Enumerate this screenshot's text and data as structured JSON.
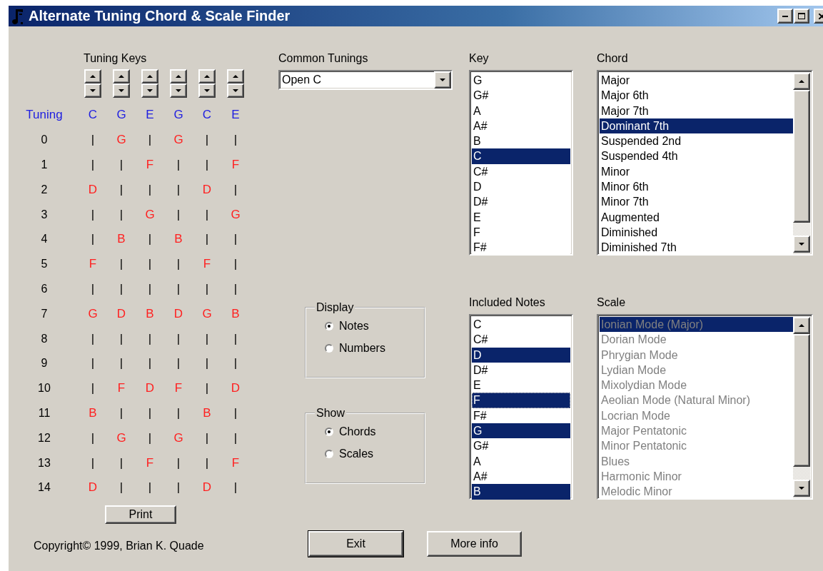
{
  "window": {
    "title": "Alternate Tuning Chord & Scale Finder"
  },
  "tuning_keys": {
    "label": "Tuning Keys"
  },
  "fretboard": {
    "header_label": "Tuning",
    "strings": [
      "C",
      "G",
      "E",
      "G",
      "C",
      "E"
    ],
    "rows": [
      {
        "fret": "0",
        "cells": [
          {
            "text": "|",
            "kind": "fret"
          },
          {
            "text": "G",
            "kind": "note"
          },
          {
            "text": "|",
            "kind": "fret"
          },
          {
            "text": "G",
            "kind": "note"
          },
          {
            "text": "|",
            "kind": "fret"
          },
          {
            "text": "|",
            "kind": "fret"
          }
        ]
      },
      {
        "fret": "1",
        "cells": [
          {
            "text": "|",
            "kind": "fret"
          },
          {
            "text": "|",
            "kind": "fret"
          },
          {
            "text": "F",
            "kind": "note"
          },
          {
            "text": "|",
            "kind": "fret"
          },
          {
            "text": "|",
            "kind": "fret"
          },
          {
            "text": "F",
            "kind": "note"
          }
        ]
      },
      {
        "fret": "2",
        "cells": [
          {
            "text": "D",
            "kind": "note"
          },
          {
            "text": "|",
            "kind": "fret"
          },
          {
            "text": "|",
            "kind": "fret"
          },
          {
            "text": "|",
            "kind": "fret"
          },
          {
            "text": "D",
            "kind": "note"
          },
          {
            "text": "|",
            "kind": "fret"
          }
        ]
      },
      {
        "fret": "3",
        "cells": [
          {
            "text": "|",
            "kind": "fret"
          },
          {
            "text": "|",
            "kind": "fret"
          },
          {
            "text": "G",
            "kind": "note"
          },
          {
            "text": "|",
            "kind": "fret"
          },
          {
            "text": "|",
            "kind": "fret"
          },
          {
            "text": "G",
            "kind": "note"
          }
        ]
      },
      {
        "fret": "4",
        "cells": [
          {
            "text": "|",
            "kind": "fret"
          },
          {
            "text": "B",
            "kind": "note"
          },
          {
            "text": "|",
            "kind": "fret"
          },
          {
            "text": "B",
            "kind": "note"
          },
          {
            "text": "|",
            "kind": "fret"
          },
          {
            "text": "|",
            "kind": "fret"
          }
        ]
      },
      {
        "fret": "5",
        "cells": [
          {
            "text": "F",
            "kind": "note"
          },
          {
            "text": "|",
            "kind": "fret"
          },
          {
            "text": "|",
            "kind": "fret"
          },
          {
            "text": "|",
            "kind": "fret"
          },
          {
            "text": "F",
            "kind": "note"
          },
          {
            "text": "|",
            "kind": "fret"
          }
        ]
      },
      {
        "fret": "6",
        "cells": [
          {
            "text": "|",
            "kind": "fret"
          },
          {
            "text": "|",
            "kind": "fret"
          },
          {
            "text": "|",
            "kind": "fret"
          },
          {
            "text": "|",
            "kind": "fret"
          },
          {
            "text": "|",
            "kind": "fret"
          },
          {
            "text": "|",
            "kind": "fret"
          }
        ]
      },
      {
        "fret": "7",
        "cells": [
          {
            "text": "G",
            "kind": "note"
          },
          {
            "text": "D",
            "kind": "note"
          },
          {
            "text": "B",
            "kind": "note"
          },
          {
            "text": "D",
            "kind": "note"
          },
          {
            "text": "G",
            "kind": "note"
          },
          {
            "text": "B",
            "kind": "note"
          }
        ]
      },
      {
        "fret": "8",
        "cells": [
          {
            "text": "|",
            "kind": "fret"
          },
          {
            "text": "|",
            "kind": "fret"
          },
          {
            "text": "|",
            "kind": "fret"
          },
          {
            "text": "|",
            "kind": "fret"
          },
          {
            "text": "|",
            "kind": "fret"
          },
          {
            "text": "|",
            "kind": "fret"
          }
        ]
      },
      {
        "fret": "9",
        "cells": [
          {
            "text": "|",
            "kind": "fret"
          },
          {
            "text": "|",
            "kind": "fret"
          },
          {
            "text": "|",
            "kind": "fret"
          },
          {
            "text": "|",
            "kind": "fret"
          },
          {
            "text": "|",
            "kind": "fret"
          },
          {
            "text": "|",
            "kind": "fret"
          }
        ]
      },
      {
        "fret": "10",
        "cells": [
          {
            "text": "|",
            "kind": "fret"
          },
          {
            "text": "F",
            "kind": "note"
          },
          {
            "text": "D",
            "kind": "note"
          },
          {
            "text": "F",
            "kind": "note"
          },
          {
            "text": "|",
            "kind": "fret"
          },
          {
            "text": "D",
            "kind": "note"
          }
        ]
      },
      {
        "fret": "11",
        "cells": [
          {
            "text": "B",
            "kind": "note"
          },
          {
            "text": "|",
            "kind": "fret"
          },
          {
            "text": "|",
            "kind": "fret"
          },
          {
            "text": "|",
            "kind": "fret"
          },
          {
            "text": "B",
            "kind": "note"
          },
          {
            "text": "|",
            "kind": "fret"
          }
        ]
      },
      {
        "fret": "12",
        "cells": [
          {
            "text": "|",
            "kind": "fret"
          },
          {
            "text": "G",
            "kind": "note"
          },
          {
            "text": "|",
            "kind": "fret"
          },
          {
            "text": "G",
            "kind": "note"
          },
          {
            "text": "|",
            "kind": "fret"
          },
          {
            "text": "|",
            "kind": "fret"
          }
        ]
      },
      {
        "fret": "13",
        "cells": [
          {
            "text": "|",
            "kind": "fret"
          },
          {
            "text": "|",
            "kind": "fret"
          },
          {
            "text": "F",
            "kind": "note"
          },
          {
            "text": "|",
            "kind": "fret"
          },
          {
            "text": "|",
            "kind": "fret"
          },
          {
            "text": "F",
            "kind": "note"
          }
        ]
      },
      {
        "fret": "14",
        "cells": [
          {
            "text": "D",
            "kind": "note"
          },
          {
            "text": "|",
            "kind": "fret"
          },
          {
            "text": "|",
            "kind": "fret"
          },
          {
            "text": "|",
            "kind": "fret"
          },
          {
            "text": "D",
            "kind": "note"
          },
          {
            "text": "|",
            "kind": "fret"
          }
        ]
      }
    ]
  },
  "print_button": "Print",
  "copyright": "Copyright© 1999, Brian K. Quade",
  "common_tunings": {
    "label": "Common Tunings",
    "value": "Open C"
  },
  "display": {
    "label": "Display",
    "options": [
      {
        "label": "Notes",
        "selected": true
      },
      {
        "label": "Numbers",
        "selected": false
      }
    ]
  },
  "show": {
    "label": "Show",
    "options": [
      {
        "label": "Chords",
        "selected": true
      },
      {
        "label": "Scales",
        "selected": false
      }
    ]
  },
  "key": {
    "label": "Key",
    "items": [
      {
        "text": "G",
        "selected": false
      },
      {
        "text": "G#",
        "selected": false
      },
      {
        "text": "A",
        "selected": false
      },
      {
        "text": "A#",
        "selected": false
      },
      {
        "text": "B",
        "selected": false
      },
      {
        "text": "C",
        "selected": true
      },
      {
        "text": "C#",
        "selected": false
      },
      {
        "text": "D",
        "selected": false
      },
      {
        "text": "D#",
        "selected": false
      },
      {
        "text": "E",
        "selected": false
      },
      {
        "text": "F",
        "selected": false
      },
      {
        "text": "F#",
        "selected": false
      }
    ]
  },
  "chord": {
    "label": "Chord",
    "items": [
      {
        "text": "Major",
        "selected": false
      },
      {
        "text": "Major 6th",
        "selected": false
      },
      {
        "text": "Major 7th",
        "selected": false
      },
      {
        "text": "Dominant 7th",
        "selected": true
      },
      {
        "text": "Suspended 2nd",
        "selected": false
      },
      {
        "text": "Suspended 4th",
        "selected": false
      },
      {
        "text": "Minor",
        "selected": false
      },
      {
        "text": "Minor 6th",
        "selected": false
      },
      {
        "text": "Minor 7th",
        "selected": false
      },
      {
        "text": "Augmented",
        "selected": false
      },
      {
        "text": "Diminished",
        "selected": false
      },
      {
        "text": "Diminished 7th",
        "selected": false
      }
    ]
  },
  "included_notes": {
    "label": "Included Notes",
    "items": [
      {
        "text": "C",
        "selected": false,
        "focused": false
      },
      {
        "text": "C#",
        "selected": false,
        "focused": false
      },
      {
        "text": "D",
        "selected": true,
        "focused": false
      },
      {
        "text": "D#",
        "selected": false,
        "focused": false
      },
      {
        "text": "E",
        "selected": false,
        "focused": false
      },
      {
        "text": "F",
        "selected": true,
        "focused": true
      },
      {
        "text": "F#",
        "selected": false,
        "focused": false
      },
      {
        "text": "G",
        "selected": true,
        "focused": false
      },
      {
        "text": "G#",
        "selected": false,
        "focused": false
      },
      {
        "text": "A",
        "selected": false,
        "focused": false
      },
      {
        "text": "A#",
        "selected": false,
        "focused": false
      },
      {
        "text": "B",
        "selected": true,
        "focused": false
      }
    ]
  },
  "scale": {
    "label": "Scale",
    "disabled": true,
    "items": [
      {
        "text": "Ionian Mode (Major)",
        "selected": true
      },
      {
        "text": "Dorian Mode",
        "selected": false
      },
      {
        "text": "Phrygian Mode",
        "selected": false
      },
      {
        "text": "Lydian Mode",
        "selected": false
      },
      {
        "text": "Mixolydian Mode",
        "selected": false
      },
      {
        "text": "Aeolian Mode (Natural Minor)",
        "selected": false
      },
      {
        "text": "Locrian Mode",
        "selected": false
      },
      {
        "text": "Major Pentatonic",
        "selected": false
      },
      {
        "text": "Minor Pentatonic",
        "selected": false
      },
      {
        "text": "Blues",
        "selected": false
      },
      {
        "text": "Harmonic Minor",
        "selected": false
      },
      {
        "text": "Melodic Minor",
        "selected": false
      }
    ]
  },
  "buttons": [
    {
      "label": "Exit",
      "default": true
    },
    {
      "label": "More info",
      "default": false
    }
  ]
}
